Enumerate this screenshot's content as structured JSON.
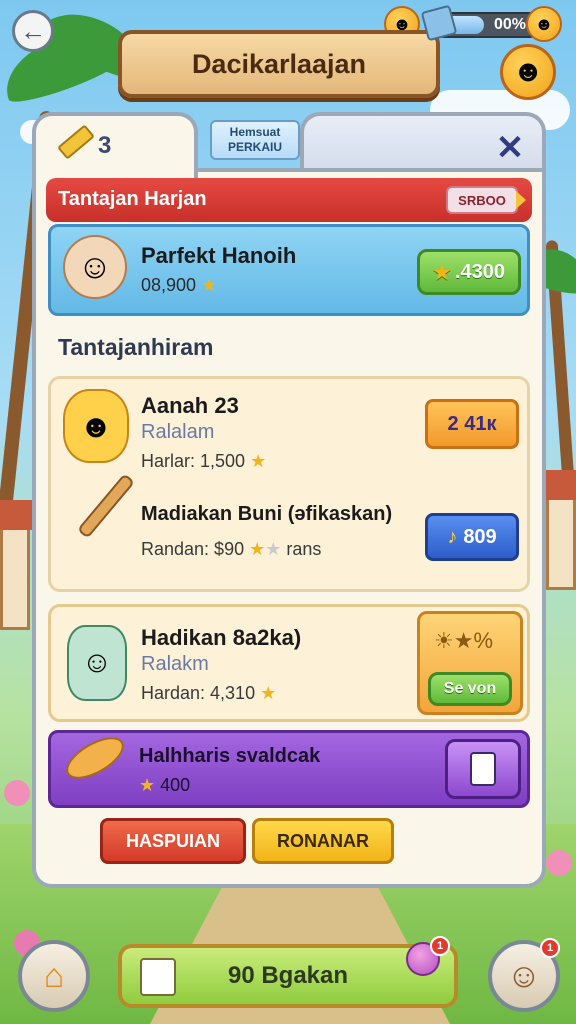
{
  "header": {
    "title": "Dacikarlaajan",
    "percent": "00%",
    "percent_fill": 0.45
  },
  "tabs": {
    "left_count": "3",
    "chip_line1": "Hemsuat",
    "chip_line2": "PERKAIU"
  },
  "daily": {
    "header": "Tantajan Harjan",
    "badge": "SRBOO",
    "title": "Parfekt Hanoih",
    "reward": "08,900",
    "button": ".4300"
  },
  "section": {
    "title": "Tantajanhiram"
  },
  "tasks": [
    {
      "title": "Aanah 23",
      "subtitle": "Ralalam",
      "reward": "Harlar: 1,500",
      "button": "2 41к"
    },
    {
      "title": "Madiakan Buni (əfikaskan)",
      "reward": "Randan: $90",
      "reward_suffix": "rans",
      "button": "809"
    },
    {
      "title": "Hadikan 8a2ka)",
      "subtitle": "Ralakm",
      "reward": "Hardan: 4,310",
      "button": "Se von"
    }
  ],
  "special": {
    "title": "Halhharis svaldcak",
    "reward": "400"
  },
  "actions": {
    "left": "HASPUIAN",
    "right": "RONANAR"
  },
  "bottom": {
    "main": "90 Bgakan",
    "left_notif": "",
    "right_notif": "1",
    "bar_notif": "1"
  },
  "colors": {
    "accent_red": "#d43a34",
    "accent_blue": "#63b9e6",
    "accent_purple": "#7e3fc2",
    "accent_green": "#5fb93a"
  }
}
